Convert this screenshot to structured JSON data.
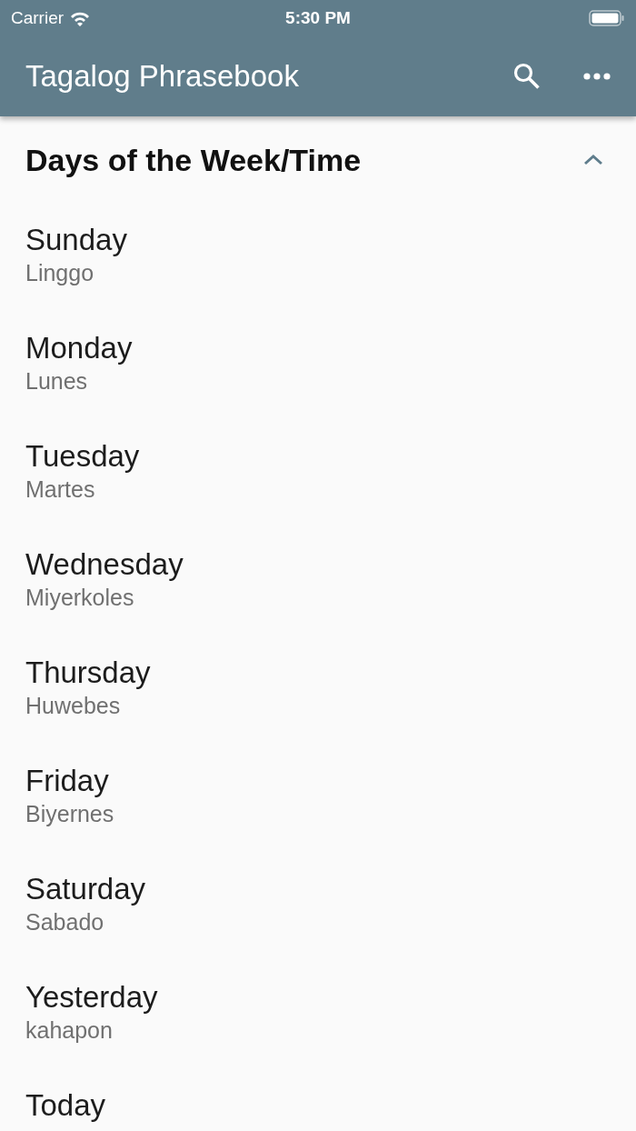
{
  "status_bar": {
    "carrier": "Carrier",
    "time": "5:30 PM"
  },
  "app_bar": {
    "title": "Tagalog Phrasebook"
  },
  "section": {
    "title": "Days of the Week/Time",
    "expanded": true,
    "phrases": [
      {
        "english": "Sunday",
        "tagalog": "Linggo"
      },
      {
        "english": "Monday",
        "tagalog": "Lunes"
      },
      {
        "english": "Tuesday",
        "tagalog": "Martes"
      },
      {
        "english": "Wednesday",
        "tagalog": "Miyerkoles"
      },
      {
        "english": "Thursday",
        "tagalog": "Huwebes"
      },
      {
        "english": "Friday",
        "tagalog": "Biyernes"
      },
      {
        "english": "Saturday",
        "tagalog": "Sabado"
      },
      {
        "english": "Yesterday",
        "tagalog": "kahapon"
      },
      {
        "english": "Today"
      }
    ]
  }
}
